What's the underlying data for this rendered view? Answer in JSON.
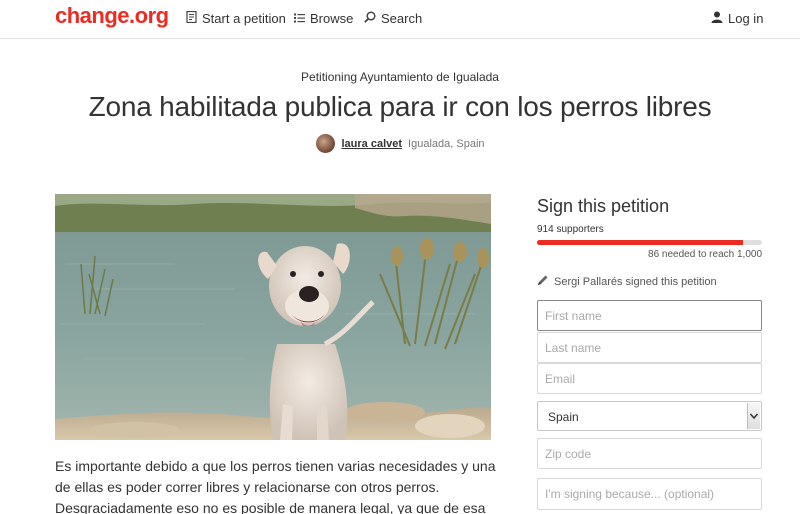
{
  "header": {
    "logo": "change.org",
    "nav": {
      "start": "Start a petition",
      "browse": "Browse",
      "search": "Search",
      "login": "Log in"
    }
  },
  "petition": {
    "target": "Petitioning Ayuntamiento de Igualada",
    "title": "Zona habilitada publica para ir con los perros libres",
    "author": {
      "name": "laura calvet",
      "location": "Igualada, Spain"
    },
    "description": "Es importante debido a que los perros tienen varias necesidades y una de ellas es poder correr libres y relacionarse con otros perros. Desgraciadamente eso no es posible de manera legal, ya que de esa"
  },
  "sign": {
    "title": "Sign this petition",
    "supporters": "914 supporters",
    "progress": 0.914,
    "needed": "86 needed to reach 1,000",
    "recent": "Sergi Pallarés signed this petition",
    "fields": {
      "first_name": "First name",
      "last_name": "Last name",
      "email": "Email",
      "country": "Spain",
      "zip": "Zip code",
      "reason": "I'm signing because... (optional)"
    }
  },
  "colors": {
    "brand": "#ec2c22",
    "progress_track": "#e0e0e0"
  },
  "icons": [
    "petition-icon",
    "list-icon",
    "search-icon",
    "user-icon",
    "pen-icon",
    "chevron-down-icon"
  ]
}
